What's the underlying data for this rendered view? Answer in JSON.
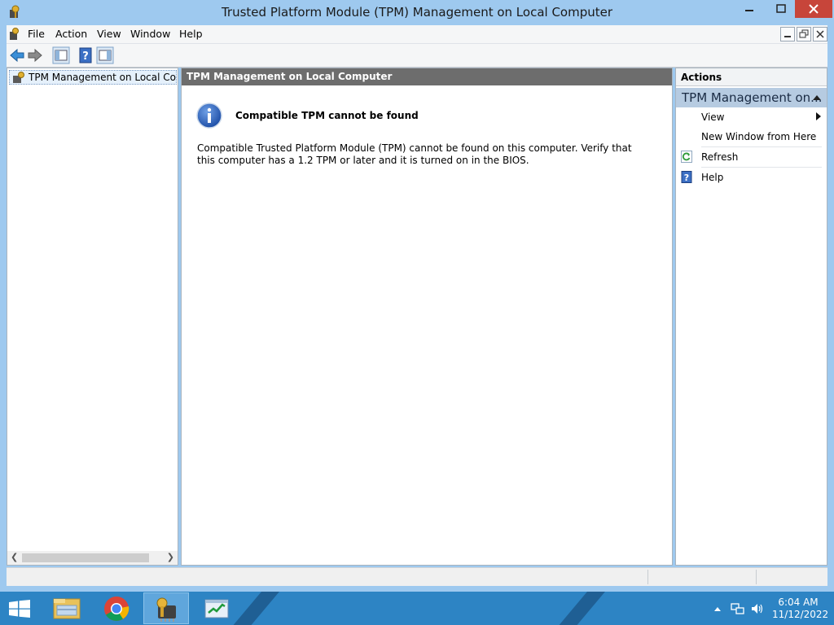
{
  "window": {
    "title": "Trusted Platform Module (TPM) Management on Local Computer",
    "buttons": {
      "minimize": "▭",
      "maximize": "□",
      "close": "✕"
    }
  },
  "menubar": {
    "items": [
      "File",
      "Action",
      "View",
      "Window",
      "Help"
    ]
  },
  "toolbar": {
    "icons": [
      "back-arrow-icon",
      "forward-arrow-icon",
      "show-hide-console-tree-icon",
      "help-icon",
      "show-hide-action-pane-icon"
    ]
  },
  "tree": {
    "root_label": "TPM Management on Local Computer"
  },
  "content": {
    "header": "TPM Management on Local Computer",
    "notice_title": "Compatible TPM cannot be found",
    "notice_body": "Compatible Trusted Platform Module (TPM) cannot be found on this computer. Verify that this computer has a 1.2 TPM or later and it is turned on in the BIOS."
  },
  "actions": {
    "header": "Actions",
    "group_label": "TPM Management on...",
    "items": [
      {
        "label": "View",
        "icon": "",
        "submenu": true
      },
      {
        "label": "New Window from Here",
        "icon": ""
      },
      {
        "label": "Refresh",
        "icon": "refresh-icon"
      },
      {
        "label": "Help",
        "icon": "help-icon"
      }
    ]
  },
  "taskbar": {
    "apps": [
      "file-explorer-icon",
      "chrome-icon",
      "tpm-management-icon",
      "task-manager-icon"
    ],
    "clock_time": "6:04 AM",
    "clock_date": "11/12/2022"
  },
  "colors": {
    "titlebar": "#9ec9ef",
    "close_button": "#c7453a",
    "content_header": "#6d6d6d",
    "actions_group": "#b6cbe1",
    "taskbar": "#2d84c4"
  }
}
